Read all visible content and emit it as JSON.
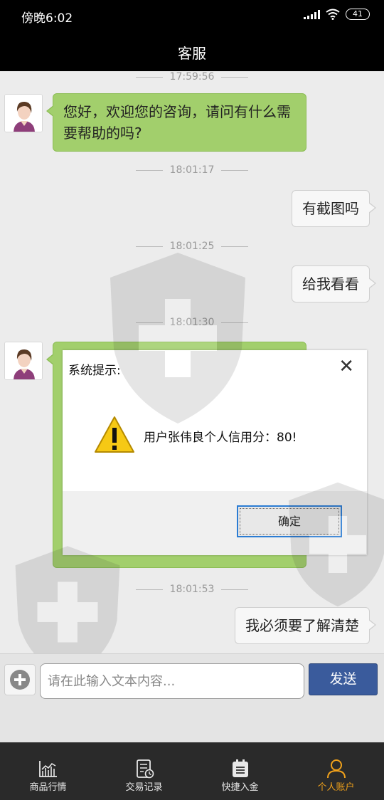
{
  "status_bar": {
    "time": "傍晚6:02",
    "battery": "41"
  },
  "title_bar": {
    "title": "客服"
  },
  "chat": {
    "messages": [
      {
        "timestamp": "17:59:56",
        "side": "left",
        "text": "您好，欢迎您的咨询，请问有什么需要帮助的吗?"
      },
      {
        "timestamp": "18:01:17",
        "side": "right",
        "text": "有截图吗"
      },
      {
        "timestamp": "18:01:25",
        "side": "right",
        "text": "给我看看"
      },
      {
        "timestamp": "18:01:30",
        "side": "left",
        "text": "",
        "image": "credit-score-dialog-screenshot"
      },
      {
        "timestamp": "18:01:53",
        "side": "right",
        "text": "我必须要了解清楚"
      }
    ]
  },
  "dialog": {
    "title": "系统提示:",
    "close_icon": "close-icon",
    "warning_icon": "warning-icon",
    "message": "用户张伟良个人信用分：80!",
    "button": "确定"
  },
  "input_bar": {
    "plus_icon": "plus-icon",
    "placeholder": "请在此输入文本内容...",
    "send": "发送"
  },
  "tabbar": {
    "items": [
      {
        "label": "商品行情",
        "icon": "market-chart-icon",
        "active": false
      },
      {
        "label": "交易记录",
        "icon": "trade-record-icon",
        "active": false
      },
      {
        "label": "快捷入金",
        "icon": "deposit-icon",
        "active": false
      },
      {
        "label": "个人账户",
        "icon": "account-icon",
        "active": true
      }
    ]
  },
  "colors": {
    "accent": "#f0a11b",
    "send_button": "#3a5b9c",
    "bubble_left": "#a2cf6c",
    "bubble_right": "#f7f7f7"
  }
}
